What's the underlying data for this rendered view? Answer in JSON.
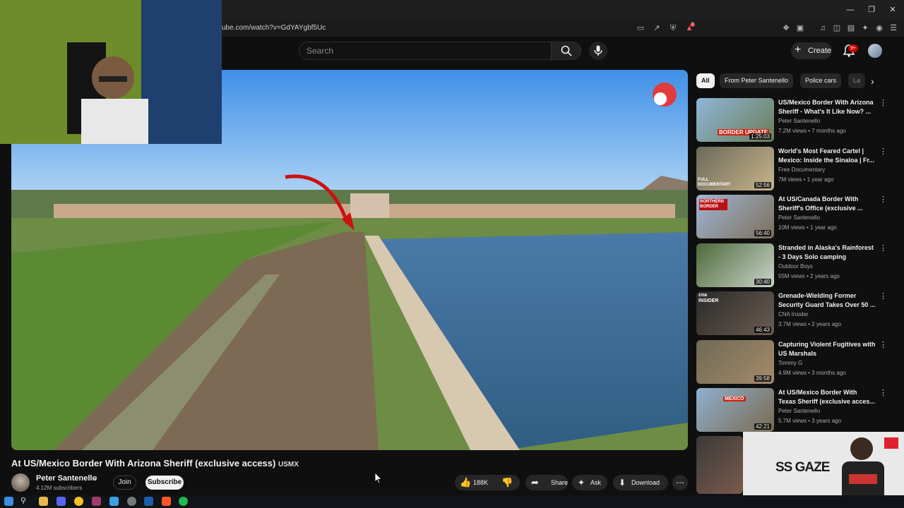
{
  "browser": {
    "url": "ube.com/watch?v=GdYAYgbf5Uc",
    "window_controls": [
      "minimize-icon",
      "restore-icon",
      "close-icon"
    ],
    "extension_badge": "3"
  },
  "header": {
    "search_placeholder": "Search",
    "create_label": "Create",
    "notification_badge": "9+"
  },
  "video": {
    "title": "At US/Mexico Border With Arizona Sheriff (exclusive access)",
    "title_tag": "USMX",
    "channel": "Peter Santenello",
    "subscribers": "4.12M subscribers",
    "join_label": "Join",
    "subscribe_label": "Subscribe",
    "likes": "188K",
    "share_label": "Share",
    "ask_label": "Ask",
    "download_label": "Download"
  },
  "filters": [
    "All",
    "From Peter Santenello",
    "Police cars",
    "La"
  ],
  "recommendations": [
    {
      "title": "US/Mexico Border With Arizona Sheriff - What's It Like Now? ...",
      "channel": "Peter Santenello",
      "meta": "7.2M views • 7 months ago",
      "duration": "1:25:03",
      "thumb_text": "BORDER UPDATE"
    },
    {
      "title": "World's Most Feared Cartel | Mexico: Inside the Sinaloa | Fr...",
      "channel": "Free Documentary",
      "meta": "7M views • 1 year ago",
      "duration": "52:56",
      "thumb_text": "FULL DOCUMENTARY"
    },
    {
      "title": "At US/Canada Border With Sheriff's Office (exclusive ...",
      "channel": "Peter Santenello",
      "meta": "10M views • 1 year ago",
      "duration": "56:40",
      "thumb_text": "NORTHERN BORDER"
    },
    {
      "title": "Stranded in Alaska's Rainforest - 3 Days Solo camping",
      "channel": "Outdoor Boys",
      "meta": "55M views • 2 years ago",
      "duration": "30:40",
      "thumb_text": ""
    },
    {
      "title": "Grenade-Wielding Former Security Guard Takes Over 50 ...",
      "channel": "CNA Insider",
      "meta": "3.7M views • 2 years ago",
      "duration": "46:43",
      "thumb_text": "cna INSIDER"
    },
    {
      "title": "Capturing Violent Fugitives with US Marshals",
      "channel": "Tommy G",
      "meta": "4.9M views • 3 months ago",
      "duration": "39:58",
      "thumb_text": ""
    },
    {
      "title": "At US/Mexico Border With Texas Sheriff (exclusive acces...",
      "channel": "Peter Santenello",
      "meta": "5.7M views • 3 years ago",
      "duration": "42:21",
      "thumb_text": "MEXICO"
    }
  ],
  "overlay": {
    "brand": "SS GAZE"
  },
  "colors": {
    "accent": "#ff0000",
    "background": "#0f0f0f",
    "chip_active": "#f1f1f1"
  }
}
